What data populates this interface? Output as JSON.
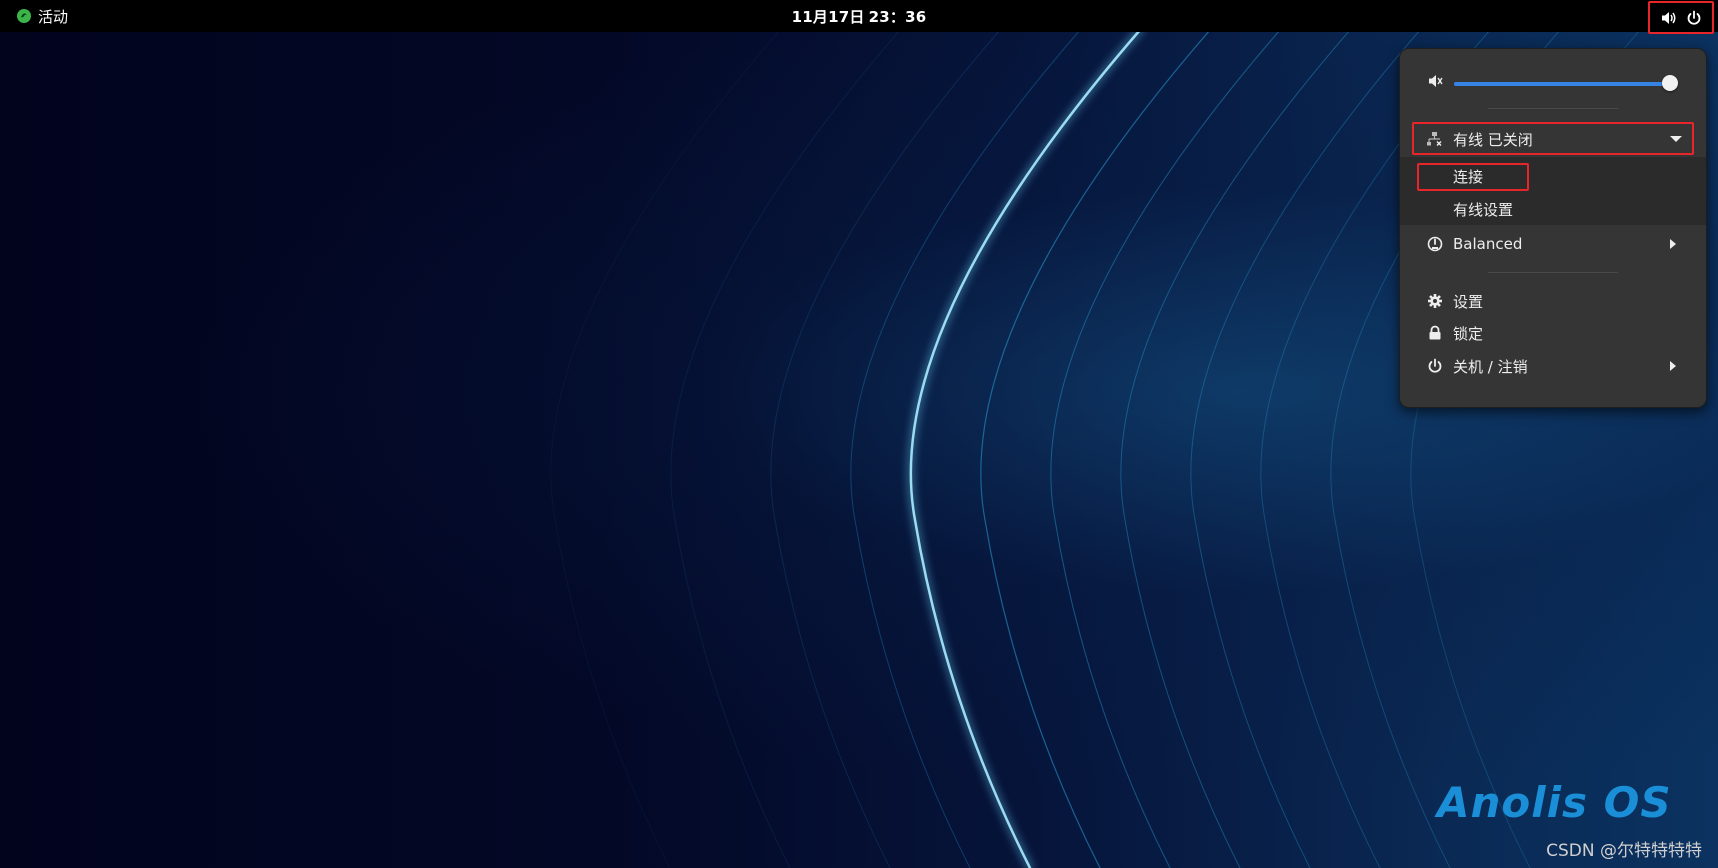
{
  "topbar": {
    "activities_label": "活动",
    "clock": {
      "date": "11月17日",
      "time": "23：36"
    },
    "tray_icons": [
      "volume-icon",
      "power-icon"
    ]
  },
  "menu": {
    "volume": {
      "icon": "volume-muted-icon",
      "level": 1.0
    },
    "wired": {
      "icon": "wired-network-offline-icon",
      "label": "有线 已关闭"
    },
    "wired_submenu": [
      {
        "label": "连接"
      },
      {
        "label": "有线设置"
      }
    ],
    "power_mode": {
      "icon": "power-profile-icon",
      "label": "Balanced"
    },
    "settings_label": "设置",
    "lock_label": "锁定",
    "shutdown_label": "关机 / 注销"
  },
  "desktop": {
    "brand": "Anolis OS",
    "watermark": "CSDN @尔特特特特"
  },
  "colors": {
    "accent": "#3584e4",
    "highlight_box": "#e8262a",
    "menu_bg": "#353535",
    "brand": "#1a8fd8"
  }
}
